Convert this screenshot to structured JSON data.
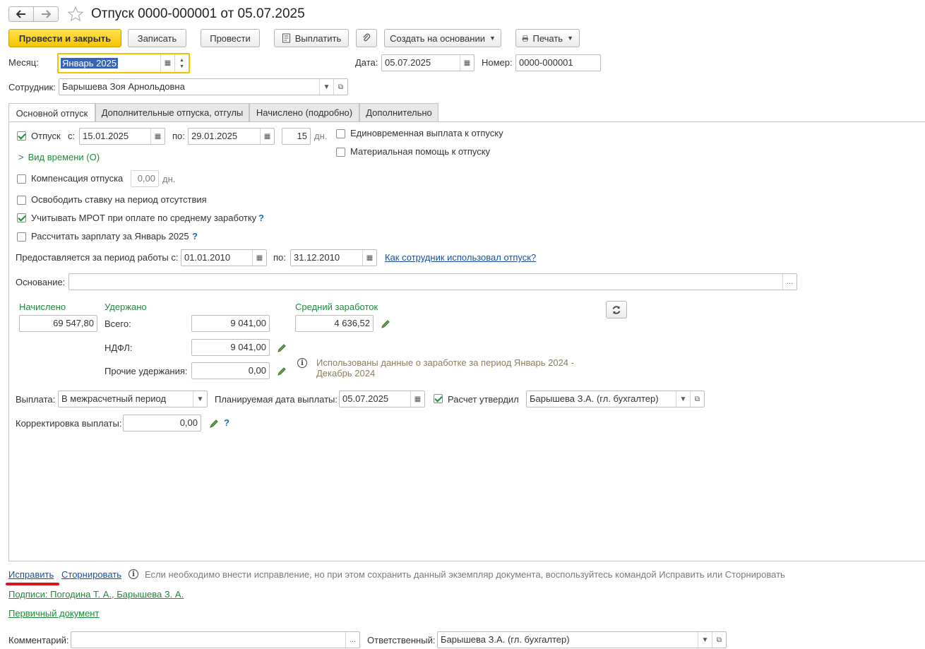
{
  "window": {
    "title": "Отпуск 0000-000001 от 05.07.2025"
  },
  "toolbar": {
    "post_close": "Провести и закрыть",
    "save": "Записать",
    "post": "Провести",
    "pay": "Выплатить",
    "create_based": "Создать на основании",
    "print": "Печать"
  },
  "header": {
    "month_label": "Месяц:",
    "month_value": "Январь 2025",
    "date_label": "Дата:",
    "date_value": "05.07.2025",
    "number_label": "Номер:",
    "number_value": "0000-000001",
    "employee_label": "Сотрудник:",
    "employee_value": "Барышева Зоя Арнольдовна"
  },
  "tabs": [
    {
      "label": "Основной отпуск",
      "active": true
    },
    {
      "label": "Дополнительные отпуска, отгулы",
      "active": false
    },
    {
      "label": "Начислено (подробно)",
      "active": false
    },
    {
      "label": "Дополнительно",
      "active": false
    }
  ],
  "main": {
    "vacation_label": "Отпуск",
    "vacation_checked": true,
    "from_label": "с:",
    "from_value": "15.01.2025",
    "to_label": "по:",
    "to_value": "29.01.2025",
    "days_value": "15",
    "days_unit": "дн.",
    "lump_sum_label": "Единовременная выплата к отпуску",
    "material_help_label": "Материальная помощь к отпуску",
    "time_kind_label": "Вид времени (О)",
    "compensation_label": "Компенсация отпуска",
    "compensation_value": "0,00",
    "compensation_unit": "дн.",
    "free_rate_label": "Освободить ставку на период отсутствия",
    "mrot_label": "Учитывать МРОТ при оплате по среднему заработку",
    "mrot_checked": true,
    "calc_salary_label": "Рассчитать зарплату за Январь 2025",
    "period_label": "Предоставляется за период работы с:",
    "period_from": "01.01.2010",
    "period_to_label": "по:",
    "period_to": "31.12.2010",
    "how_used_link": "Как сотрудник использовал отпуск?",
    "basis_label": "Основание:",
    "basis_value": ""
  },
  "amounts": {
    "accrued_label": "Начислено",
    "accrued_value": "69 547,80",
    "withheld_label": "Удержано",
    "total_label": "Всего:",
    "total_value": "9 041,00",
    "ndfl_label": "НДФЛ:",
    "ndfl_value": "9 041,00",
    "other_label": "Прочие удержания:",
    "other_value": "0,00",
    "avg_label": "Средний заработок",
    "avg_value": "4 636,52",
    "info_text_1": "Использованы данные о заработке за период Январь 2024 -",
    "info_text_2": "Декабрь 2024"
  },
  "payment": {
    "label": "Выплата:",
    "value": "В межрасчетный период",
    "planned_label": "Планируемая дата выплаты:",
    "planned_value": "05.07.2025",
    "approved_label": "Расчет утвердил",
    "approved_checked": true,
    "approver_value": "Барышева З.А. (гл. бухгалтер)",
    "correction_label": "Корректировка выплаты:",
    "correction_value": "0,00"
  },
  "footer": {
    "fix_link": "Исправить",
    "reverse_link": "Сторнировать",
    "hint": "Если необходимо внести исправление, но при этом сохранить данный экземпляр документа, воспользуйтесь командой Исправить или Сторнировать",
    "signatures_link": "Подписи: Погодина Т. А., Барышева З. А.",
    "primary_doc_link": "Первичный документ",
    "comment_label": "Комментарий:",
    "comment_value": "",
    "responsible_label": "Ответственный:",
    "responsible_value": "Барышева З.А. (гл. бухгалтер)"
  },
  "colors": {
    "primary_button": "#f4c500",
    "accent_green": "#1f8a3b",
    "link_blue": "#1a4f9c",
    "annotation_red": "#d9141b"
  }
}
